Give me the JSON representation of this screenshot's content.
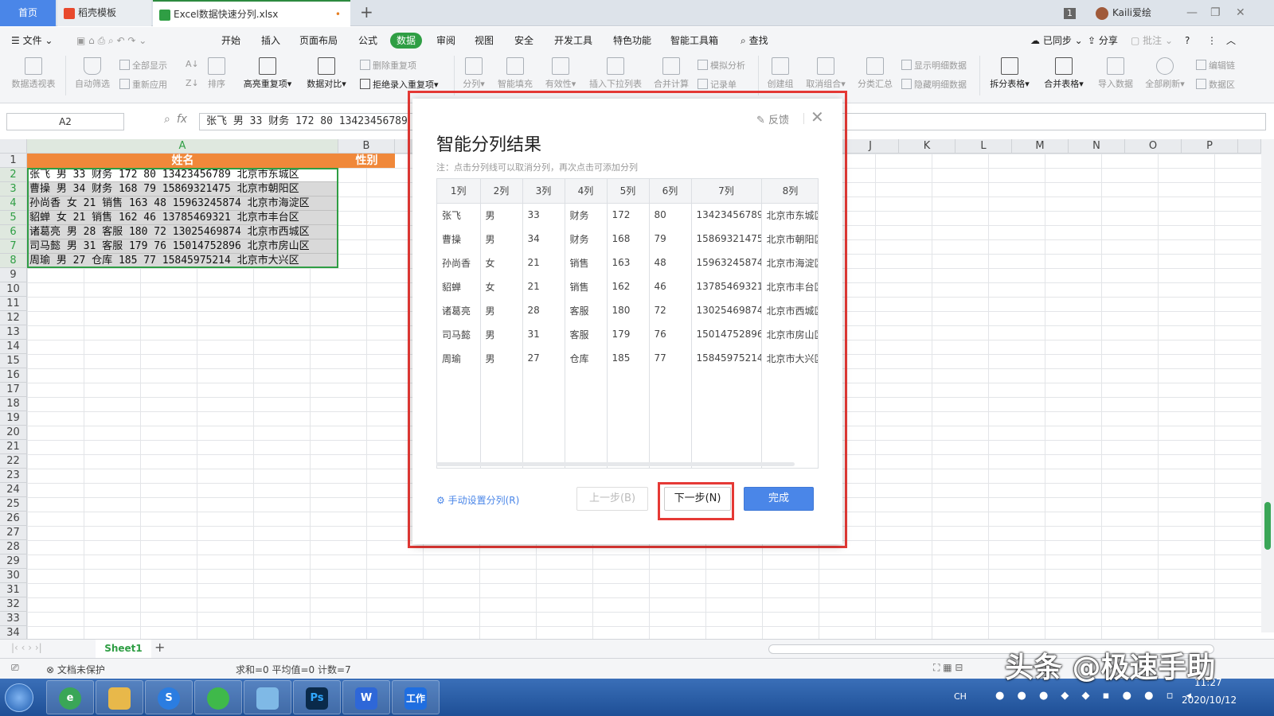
{
  "tabs": {
    "home": "首页",
    "template": "稻壳模板",
    "file": "Excel数据快速分列.xlsx",
    "file_dot": "•"
  },
  "titlebar": {
    "badge": "1",
    "user": "Kaili爱绘"
  },
  "menu": {
    "file": "文件",
    "items": [
      "开始",
      "插入",
      "页面布局",
      "公式",
      "数据",
      "审阅",
      "视图",
      "安全",
      "开发工具",
      "特色功能",
      "智能工具箱"
    ],
    "search": "查找",
    "sync": "已同步",
    "share": "分享",
    "annotate": "批注"
  },
  "ribbon": {
    "pivot": "数据透视表",
    "autofilter": "自动筛选",
    "showall": "全部显示",
    "reapply": "重新应用",
    "sort": "排序",
    "highlight_dup": "高亮重复项",
    "compare": "数据对比",
    "delete_dup": "删除重复项",
    "reject_dup": "拒绝录入重复项",
    "split": "分列",
    "smartfill": "智能填充",
    "validity": "有效性",
    "dropdown": "插入下拉列表",
    "merge_calc": "合并计算",
    "simulate": "模拟分析",
    "record": "记录单",
    "create_group": "创建组",
    "ungroup": "取消组合",
    "subtotal": "分类汇总",
    "show_detail": "显示明细数据",
    "hide_detail": "隐藏明细数据",
    "split_table": "拆分表格",
    "merge_table": "合并表格",
    "import": "导入数据",
    "refresh_all": "全部刷新",
    "edit_link": "编辑链",
    "data_src": "数据区"
  },
  "formula": {
    "cell": "A2",
    "fx": "fx",
    "value": "张飞 男 33 财务 172 80 13423456789 北京市东城区"
  },
  "sheet": {
    "cols": [
      "A",
      "B",
      "",
      "",
      "",
      "",
      "",
      "",
      "",
      "J",
      "K",
      "L",
      "M",
      "N",
      "O",
      "P"
    ],
    "header_a": "姓名",
    "header_b": "性别",
    "rows": [
      "张飞 男 33 财务 172 80 13423456789 北京市东城区",
      "曹操 男 34 财务 168 79 15869321475 北京市朝阳区",
      "孙尚香 女 21 销售 163 48 15963245874 北京市海淀区",
      "貂蝉 女 21 销售 162 46 13785469321 北京市丰台区",
      "诸葛亮 男 28 客服 180 72 13025469874 北京市西城区",
      "司马懿 男 31 客服 179 76 15014752896 北京市房山区",
      "周瑜 男 27 仓库 185 77 15845975214 北京市大兴区"
    ],
    "tab": "Sheet1"
  },
  "status": {
    "protect": "文档未保护",
    "stats": "求和=0  平均值=0  计数=7"
  },
  "dialog": {
    "title": "智能分列结果",
    "note": "注：点击分列线可以取消分列，再次点击可添加分列",
    "feedback": "反馈",
    "columns": [
      "1列",
      "2列",
      "3列",
      "4列",
      "5列",
      "6列",
      "7列",
      "8列"
    ],
    "rows": [
      [
        "张飞",
        "男",
        "33",
        "财务",
        "172",
        "80",
        "13423456789",
        "北京市东城区"
      ],
      [
        "曹操",
        "男",
        "34",
        "财务",
        "168",
        "79",
        "15869321475",
        "北京市朝阳区"
      ],
      [
        "孙尚香",
        "女",
        "21",
        "销售",
        "163",
        "48",
        "15963245874",
        "北京市海淀区"
      ],
      [
        "貂蝉",
        "女",
        "21",
        "销售",
        "162",
        "46",
        "13785469321",
        "北京市丰台区"
      ],
      [
        "诸葛亮",
        "男",
        "28",
        "客服",
        "180",
        "72",
        "13025469874",
        "北京市西城区"
      ],
      [
        "司马懿",
        "男",
        "31",
        "客服",
        "179",
        "76",
        "15014752896",
        "北京市房山区"
      ],
      [
        "周瑜",
        "男",
        "27",
        "仓库",
        "185",
        "77",
        "15845975214",
        "北京市大兴区"
      ]
    ],
    "manual": "手动设置分列(R)",
    "prev": "上一步(B)",
    "next": "下一步(N)",
    "done": "完成"
  },
  "taskbar": {
    "ps": "Ps",
    "wps": "W",
    "work": "工作",
    "lang": "CH",
    "time": "11:27",
    "date": "2020/10/12"
  },
  "watermark": "头条 @极速手助"
}
